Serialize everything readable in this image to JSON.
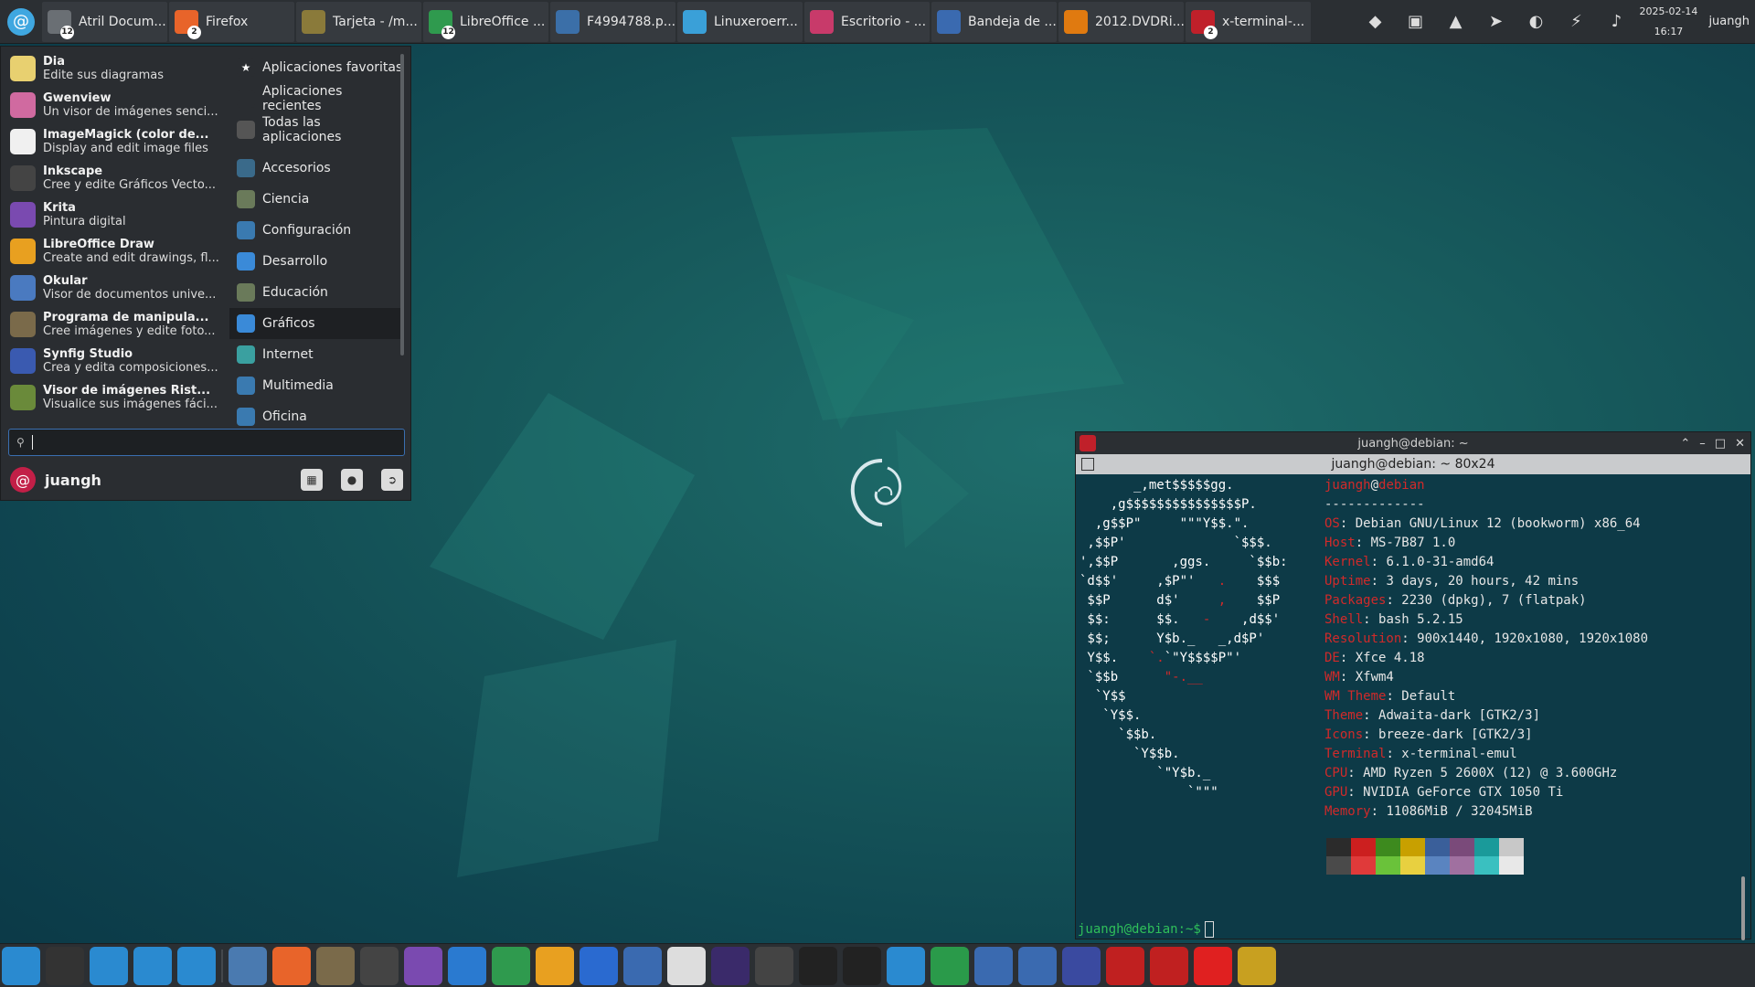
{
  "top_panel": {
    "menu_button_icon": "debian-swirl-icon",
    "tasks": [
      {
        "label": "Atril Docum...",
        "icon": "document-viewer-icon",
        "badge": "12",
        "color": "#6a6f74"
      },
      {
        "label": "Firefox",
        "icon": "firefox-icon",
        "badge": "2",
        "color": "#e8642a"
      },
      {
        "label": "Tarjeta - /m...",
        "icon": "teapot-icon",
        "badge": "",
        "color": "#8a7a3a"
      },
      {
        "label": "LibreOffice ...",
        "icon": "libreoffice-calc-icon",
        "badge": "12",
        "color": "#2f9a4e"
      },
      {
        "label": "F4994788.p...",
        "icon": "browser-icon",
        "badge": "",
        "color": "#3b6fa8"
      },
      {
        "label": "Linuxeroerr...",
        "icon": "telegram-icon",
        "badge": "",
        "color": "#3aa0d8"
      },
      {
        "label": "Escritorio - ...",
        "icon": "desktop-icon",
        "badge": "",
        "color": "#c83a6a"
      },
      {
        "label": "Bandeja de ...",
        "icon": "thunderbird-icon",
        "badge": "",
        "color": "#3a6ab0"
      },
      {
        "label": "2012.DVDRi...",
        "icon": "vlc-icon",
        "badge": "",
        "color": "#e07a10"
      },
      {
        "label": "x-terminal-...",
        "icon": "terminal-icon",
        "badge": "2",
        "color": "#c0202a"
      }
    ],
    "tray": [
      {
        "icon": "anydesk-icon"
      },
      {
        "icon": "network-icon"
      },
      {
        "icon": "vlc-tray-icon"
      },
      {
        "icon": "telegram-tray-icon"
      },
      {
        "icon": "volume-icon"
      },
      {
        "icon": "power-icon"
      },
      {
        "icon": "notifications-bell-icon"
      }
    ],
    "date": "2025-02-14",
    "time": "16:17",
    "user": "juangh"
  },
  "menu": {
    "apps": [
      {
        "name": "Dia",
        "desc": "Edite sus diagramas",
        "icon": "dia-icon",
        "color": "#e8d070"
      },
      {
        "name": "Gwenview",
        "desc": "Un visor de imágenes senci...",
        "icon": "gwenview-icon",
        "color": "#d06aa0"
      },
      {
        "name": "ImageMagick (color de...",
        "desc": "Display and edit image files",
        "icon": "imagemagick-icon",
        "color": "#f0f0f0"
      },
      {
        "name": "Inkscape",
        "desc": "Cree y edite Gráficos Vecto...",
        "icon": "inkscape-icon",
        "color": "#444"
      },
      {
        "name": "Krita",
        "desc": "Pintura digital",
        "icon": "krita-icon",
        "color": "#7a4ab0"
      },
      {
        "name": "LibreOffice Draw",
        "desc": "Create and edit drawings, fl...",
        "icon": "libreoffice-draw-icon",
        "color": "#e8a020"
      },
      {
        "name": "Okular",
        "desc": "Visor de documentos unive...",
        "icon": "okular-icon",
        "color": "#4a7ac0"
      },
      {
        "name": "Programa de manipula...",
        "desc": "Cree imágenes y edite foto...",
        "icon": "gimp-icon",
        "color": "#7a6a4a"
      },
      {
        "name": "Synfig Studio",
        "desc": "Crea y edita composiciones...",
        "icon": "synfig-icon",
        "color": "#3a5ab0"
      },
      {
        "name": "Visor de imágenes Rist...",
        "desc": "Visualice sus imágenes fáci...",
        "icon": "ristretto-icon",
        "color": "#6a8a3a"
      }
    ],
    "categories": [
      {
        "label": "Aplicaciones favoritas",
        "icon": "star-icon",
        "color": "#2a2d31"
      },
      {
        "label": "Aplicaciones recientes",
        "icon": "recent-icon",
        "color": "#2a2d31"
      },
      {
        "label": "Todas las aplicaciones",
        "icon": "all-apps-icon",
        "color": "#555"
      },
      {
        "label": "Accesorios",
        "icon": "accessories-icon",
        "color": "#3a6a8a"
      },
      {
        "label": "Ciencia",
        "icon": "science-icon",
        "color": "#6a7a5a"
      },
      {
        "label": "Configuración",
        "icon": "settings-icon",
        "color": "#3a7ab0"
      },
      {
        "label": "Desarrollo",
        "icon": "development-icon",
        "color": "#3a8ad8"
      },
      {
        "label": "Educación",
        "icon": "education-icon",
        "color": "#6a7a5a"
      },
      {
        "label": "Gráficos",
        "icon": "graphics-icon",
        "color": "#3a8ad8"
      },
      {
        "label": "Internet",
        "icon": "internet-icon",
        "color": "#3aa0a0"
      },
      {
        "label": "Multimedia",
        "icon": "multimedia-icon",
        "color": "#3a7ab0"
      },
      {
        "label": "Oficina",
        "icon": "office-icon",
        "color": "#3a7ab0"
      }
    ],
    "active_category": "Gráficos",
    "search_value": "",
    "user": "juangh"
  },
  "terminal": {
    "window_title": "juangh@debian: ~",
    "sub_title": "juangh@debian: ~ 80x24",
    "user": "juangh",
    "host": "debian",
    "separator": "-------------",
    "info": [
      {
        "key": "OS",
        "value": "Debian GNU/Linux 12 (bookworm) x86_64"
      },
      {
        "key": "Host",
        "value": "MS-7B87 1.0"
      },
      {
        "key": "Kernel",
        "value": "6.1.0-31-amd64"
      },
      {
        "key": "Uptime",
        "value": "3 days, 20 hours, 42 mins"
      },
      {
        "key": "Packages",
        "value": "2230 (dpkg), 7 (flatpak)"
      },
      {
        "key": "Shell",
        "value": "bash 5.2.15"
      },
      {
        "key": "Resolution",
        "value": "900x1440, 1920x1080, 1920x1080"
      },
      {
        "key": "DE",
        "value": "Xfce 4.18"
      },
      {
        "key": "WM",
        "value": "Xfwm4"
      },
      {
        "key": "WM Theme",
        "value": "Default"
      },
      {
        "key": "Theme",
        "value": "Adwaita-dark [GTK2/3]"
      },
      {
        "key": "Icons",
        "value": "breeze-dark [GTK2/3]"
      },
      {
        "key": "Terminal",
        "value": "x-terminal-emul"
      },
      {
        "key": "CPU",
        "value": "AMD Ryzen 5 2600X (12) @ 3.600GHz"
      },
      {
        "key": "GPU",
        "value": "NVIDIA GeForce GTX 1050 Ti"
      },
      {
        "key": "Memory",
        "value": "11086MiB / 32045MiB"
      }
    ],
    "palette_top": [
      "#2b2b2b",
      "#cc1f1f",
      "#3d8a1e",
      "#c8a000",
      "#3a5f9a",
      "#7a4a7a",
      "#1a9a9a",
      "#c8c8c8"
    ],
    "palette_bottom": [
      "#4a4a4a",
      "#e03a3a",
      "#6ac23a",
      "#e8d040",
      "#5a84c0",
      "#a070a0",
      "#3ac0c0",
      "#e8e8e8"
    ],
    "prompt": "juangh@debian:~$"
  },
  "dock": [
    {
      "icon": "show-desktop-icon",
      "color": "#2a8ad0"
    },
    {
      "icon": "terminal-icon",
      "color": "#333"
    },
    {
      "icon": "file-manager-icon",
      "color": "#2a8ad0"
    },
    {
      "icon": "web-browser-icon",
      "color": "#2a8ad0"
    },
    {
      "icon": "app-finder-icon",
      "color": "#2a8ad0"
    },
    {
      "icon": "folder-icon",
      "color": "#4a7ab0"
    },
    {
      "icon": "firefox-icon",
      "color": "#e8642a"
    },
    {
      "icon": "gimp-icon",
      "color": "#7a6a4a"
    },
    {
      "icon": "inkscape-icon",
      "color": "#444"
    },
    {
      "icon": "krita-icon",
      "color": "#7a4ab0"
    },
    {
      "icon": "libreoffice-writer-icon",
      "color": "#2a7ad0"
    },
    {
      "icon": "libreoffice-calc-icon",
      "color": "#2f9a4e"
    },
    {
      "icon": "libreoffice-impress-icon",
      "color": "#e8a020"
    },
    {
      "icon": "chromium-icon",
      "color": "#2a6ad0"
    },
    {
      "icon": "thunderbird-icon",
      "color": "#3a6ab0"
    },
    {
      "icon": "file-icon",
      "color": "#ddd"
    },
    {
      "icon": "stellarium-icon",
      "color": "#3a2a6a"
    },
    {
      "icon": "telescope-icon",
      "color": "#444"
    },
    {
      "icon": "audacity-icon",
      "color": "#222"
    },
    {
      "icon": "obs-icon",
      "color": "#222"
    },
    {
      "icon": "remote-desktop-icon",
      "color": "#2a8ad0"
    },
    {
      "icon": "headset-icon",
      "color": "#2a9a4a"
    },
    {
      "icon": "kdenlive-icon",
      "color": "#3a6ab0"
    },
    {
      "icon": "photo-manager-icon",
      "color": "#3a6ab0"
    },
    {
      "icon": "stellarium-icon",
      "color": "#3a4aa0"
    },
    {
      "icon": "blocked-icon",
      "color": "#c02020"
    },
    {
      "icon": "blocked-icon",
      "color": "#c02020"
    },
    {
      "icon": "anydesk-icon",
      "color": "#e02020"
    },
    {
      "icon": "teapot-icon",
      "color": "#c8a020"
    }
  ]
}
